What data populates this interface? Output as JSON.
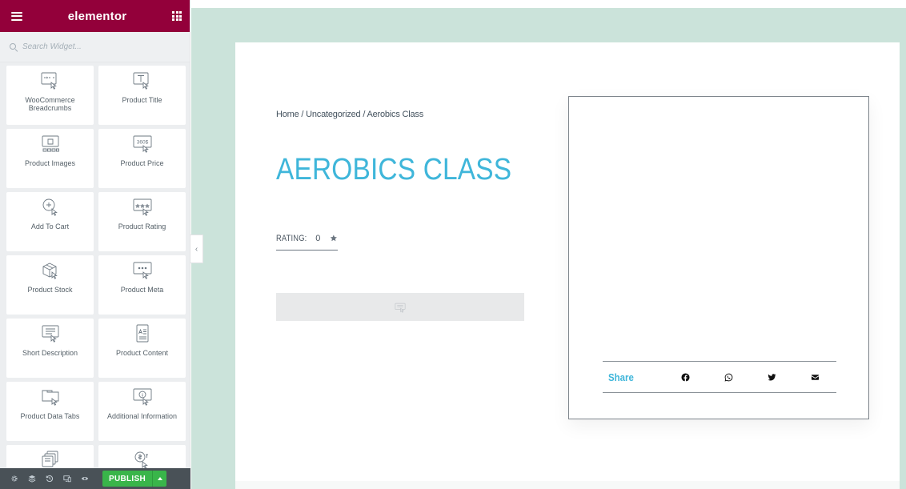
{
  "sidebar": {
    "brand": "elementor",
    "search": {
      "placeholder": "Search Widget..."
    },
    "widgets": [
      {
        "label": "WooCommerce Breadcrumbs",
        "icon": "breadcrumbs-icon"
      },
      {
        "label": "Product Title",
        "icon": "product-title-icon"
      },
      {
        "label": "Product Images",
        "icon": "product-images-icon"
      },
      {
        "label": "Product Price",
        "icon": "product-price-icon",
        "icon_text": "360$"
      },
      {
        "label": "Add To Cart",
        "icon": "add-to-cart-icon"
      },
      {
        "label": "Product Rating",
        "icon": "product-rating-icon"
      },
      {
        "label": "Product Stock",
        "icon": "product-stock-icon"
      },
      {
        "label": "Product Meta",
        "icon": "product-meta-icon"
      },
      {
        "label": "Short Description",
        "icon": "short-description-icon"
      },
      {
        "label": "Product Content",
        "icon": "product-content-icon"
      },
      {
        "label": "Product Data Tabs",
        "icon": "product-data-tabs-icon"
      },
      {
        "label": "Additional Information",
        "icon": "additional-information-icon"
      },
      {
        "label": "",
        "icon": "product-related-icon"
      },
      {
        "label": "",
        "icon": "product-upsell-icon"
      }
    ],
    "footer": {
      "publish_label": "PUBLISH",
      "icons": [
        "settings-icon",
        "navigator-icon",
        "history-icon",
        "responsive-icon",
        "preview-icon"
      ]
    }
  },
  "canvas": {
    "breadcrumb": [
      "Home",
      " / ",
      "Uncategorized",
      " / ",
      "Aerobics Class"
    ],
    "title": "AEROBICS CLASS",
    "rating": {
      "label": "RATING:",
      "value": "0"
    },
    "share": {
      "label": "Share",
      "icons": [
        "facebook-icon",
        "whatsapp-icon",
        "twitter-icon",
        "email-icon"
      ]
    }
  },
  "colors": {
    "brand": "#93003a",
    "accent": "#3fb6da",
    "canvas_bg": "#cbe3da",
    "publish": "#39b54a",
    "footer_bg": "#495157"
  }
}
